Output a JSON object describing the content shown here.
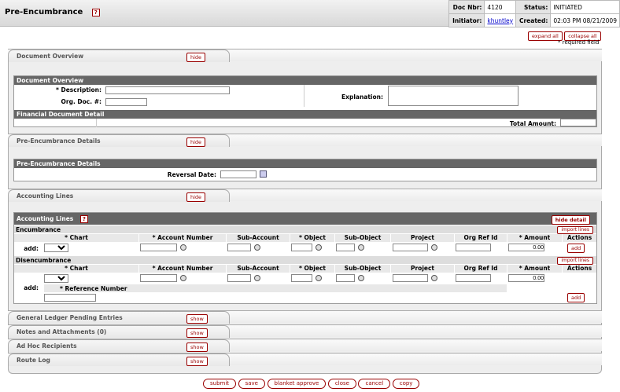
{
  "header": {
    "title": "Pre-Encumbrance",
    "help_icon": "?",
    "doc_nbr_label": "Doc Nbr:",
    "doc_nbr": "4120",
    "status_label": "Status:",
    "status": "INITIATED",
    "initiator_label": "Initiator:",
    "initiator": "khuntley",
    "created_label": "Created:",
    "created": "02:03 PM 08/21/2009"
  },
  "top_controls": {
    "expand_all": "expand all",
    "collapse_all": "collapse all",
    "required_note": "* required field"
  },
  "doc_overview": {
    "tab_label": "Document Overview",
    "tab_button": "hide",
    "section_title": "Document Overview",
    "description_label": "* Description:",
    "org_doc_label": "Org. Doc. #:",
    "explanation_label": "Explanation:",
    "fin_detail_title": "Financial Document Detail",
    "total_amount_label": "Total Amount:"
  },
  "pre_enc": {
    "tab_label": "Pre-Encumbrance Details",
    "tab_button": "hide",
    "section_title": "Pre-Encumbrance Details",
    "reversal_date_label": "Reversal Date:"
  },
  "accounting": {
    "tab_label": "Accounting Lines",
    "tab_button": "hide",
    "section_title": "Accounting Lines",
    "hide_detail": "hide detail",
    "encumbrance_title": "Encumbrance",
    "disencumbrance_title": "Disencumbrance",
    "import_lines": "import lines",
    "columns": [
      "* Chart",
      "* Account Number",
      "Sub-Account",
      "* Object",
      "Sub-Object",
      "Project",
      "Org Ref Id",
      "* Amount",
      "Actions"
    ],
    "add_label": "add:",
    "add_button": "add",
    "enc_amount": "0.00",
    "dis_amount": "0.00",
    "reference_number_label": "* Reference Number"
  },
  "collapsed_tabs": [
    {
      "label": "General Ledger Pending Entries",
      "button": "show"
    },
    {
      "label": "Notes and Attachments (0)",
      "button": "show"
    },
    {
      "label": "Ad Hoc Recipients",
      "button": "show"
    },
    {
      "label": "Route Log",
      "button": "show"
    }
  ],
  "bottom_buttons": {
    "submit": "submit",
    "save": "save",
    "blanket_approve": "blanket approve",
    "close": "close",
    "cancel": "cancel",
    "copy": "copy"
  }
}
